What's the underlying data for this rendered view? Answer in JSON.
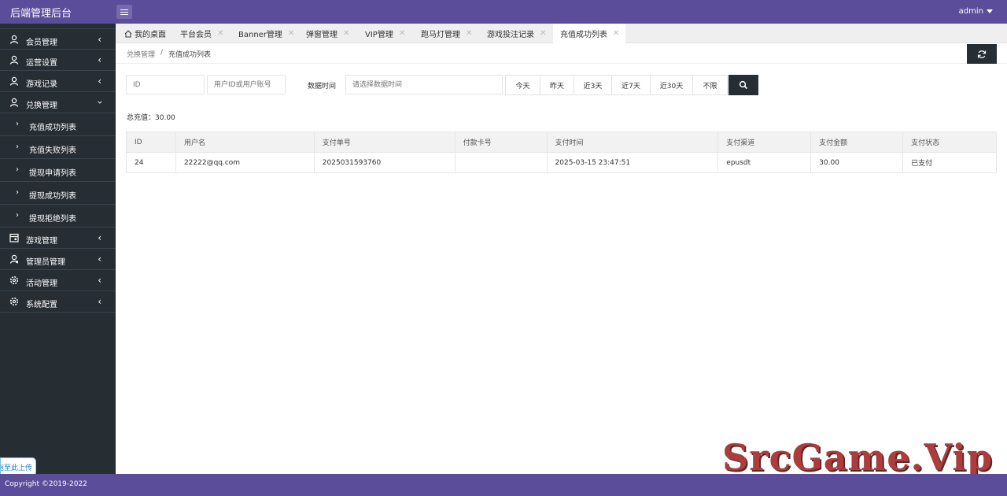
{
  "app": {
    "title": "后端管理后台",
    "user": "admin"
  },
  "sidebar": {
    "groups_top": [
      {
        "label": "会员管理",
        "icon": "user-icon"
      },
      {
        "label": "运营设置",
        "icon": "user-icon"
      },
      {
        "label": "游戏记录",
        "icon": "user-icon"
      },
      {
        "label": "兑换管理",
        "icon": "user-icon",
        "expanded": true
      }
    ],
    "sub_items": [
      {
        "label": "充值成功列表"
      },
      {
        "label": "充值失败列表"
      },
      {
        "label": "提现申请列表"
      },
      {
        "label": "提现成功列表"
      },
      {
        "label": "提现拒绝列表"
      }
    ],
    "groups_bottom": [
      {
        "label": "游戏管理",
        "icon": "calendar-icon"
      },
      {
        "label": "管理员管理",
        "icon": "admin-icon"
      },
      {
        "label": "活动管理",
        "icon": "gear-icon"
      },
      {
        "label": "系统配置",
        "icon": "gear-icon"
      }
    ],
    "upload_label": "拖至此上传"
  },
  "tabs": [
    {
      "label": "我的桌面",
      "closable": false
    },
    {
      "label": "平台会员",
      "closable": true
    },
    {
      "label": "Banner管理",
      "closable": true
    },
    {
      "label": "弹窗管理",
      "closable": true
    },
    {
      "label": "VIP管理",
      "closable": true
    },
    {
      "label": "跑马灯管理",
      "closable": true
    },
    {
      "label": "游戏投注记录",
      "closable": true
    },
    {
      "label": "充值成功列表",
      "closable": true,
      "active": true
    }
  ],
  "breadcrumb": {
    "parent": "兑换管理",
    "separator": "/",
    "current": "充值成功列表"
  },
  "filters": {
    "id_placeholder": "ID",
    "user_placeholder": "用户ID或用户账号",
    "time_label": "数据时间",
    "time_placeholder": "请选择数据时间",
    "quick_ranges": [
      "今天",
      "昨天",
      "近3天",
      "近7天",
      "近30天",
      "不限"
    ]
  },
  "summary": {
    "label": "总充值：",
    "value": "30.00"
  },
  "table": {
    "headers": [
      "ID",
      "用户名",
      "支付单号",
      "付款卡号",
      "支付时间",
      "支付渠道",
      "支付金额",
      "支付状态"
    ],
    "rows": [
      [
        "24",
        "22222@qq.com",
        "2025031593760",
        "",
        "2025-03-15 23:47:51",
        "epusdt",
        "30.00",
        "已支付"
      ]
    ]
  },
  "footer": {
    "copyright": "Copyright ©2019-2022"
  },
  "watermark": {
    "text": "SrcGame.Vip"
  },
  "colors": {
    "header_bg": "#5b4d99",
    "sidebar_bg": "#262d33",
    "dark_button": "#262d33",
    "watermark": "#ad3d3d"
  }
}
